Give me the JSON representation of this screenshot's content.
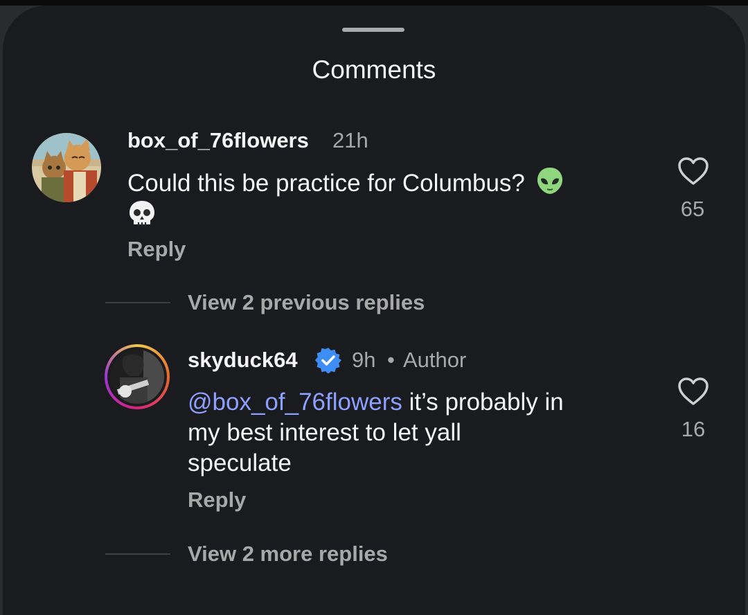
{
  "sheet": {
    "title": "Comments"
  },
  "comments": [
    {
      "username": "box_of_76flowers",
      "time": "21h",
      "text": "Could this be practice for Columbus?",
      "emojis": [
        "alien-emoji",
        "skull-emoji"
      ],
      "reply_label": "Reply",
      "likes": "65"
    }
  ],
  "thread": {
    "previous_replies": "View 2 previous replies",
    "reply": {
      "username": "skyduck64",
      "verified": true,
      "time": "9h",
      "separator": "•",
      "role": "Author",
      "mention": "@box_of_76flowers",
      "text_line1": " it’s probably in",
      "text_line2": "my best interest to let yall",
      "text_line3": "speculate",
      "reply_label": "Reply",
      "likes": "16"
    },
    "more_replies": "View 2 more replies"
  },
  "colors": {
    "background": "#1a1b1e",
    "mention": "#8ea0ff",
    "verified": "#3d8df5",
    "muted": "#a8a8a8"
  }
}
